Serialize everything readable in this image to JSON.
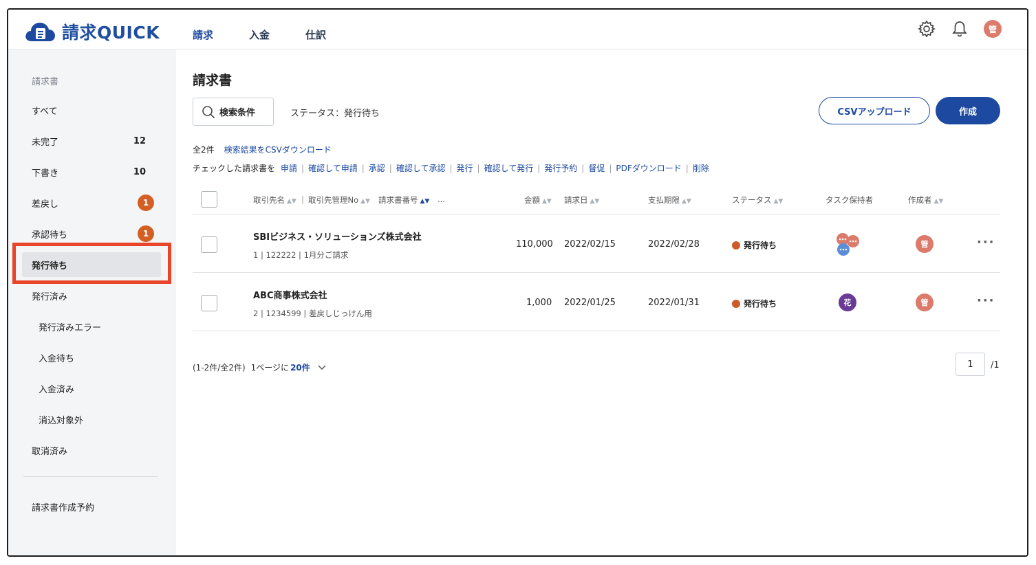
{
  "app": {
    "name": "請求QUICK",
    "brand_color": "#1d4aa0",
    "accent_color": "#d45f24"
  },
  "header": {
    "tabs": [
      {
        "label": "請求",
        "active": true
      },
      {
        "label": "入金",
        "active": false
      },
      {
        "label": "仕訳",
        "active": false
      }
    ],
    "icons": [
      "gear-icon",
      "bell-icon"
    ],
    "user_avatar": "管"
  },
  "sidebar": {
    "heading": "請求書",
    "items": [
      {
        "label": "すべて"
      },
      {
        "label": "未完了",
        "count": "12"
      },
      {
        "label": "下書き",
        "count": "10"
      },
      {
        "label": "差戻し",
        "badge": "1"
      },
      {
        "label": "承認待ち",
        "badge": "1"
      },
      {
        "label": "発行待ち",
        "selected": true
      },
      {
        "label": "発行済み"
      },
      {
        "label": "発行済みエラー"
      },
      {
        "label": "入金待ち"
      },
      {
        "label": "入金済み"
      },
      {
        "label": "消込対象外"
      },
      {
        "label": "取消済み"
      }
    ],
    "footer_item": "請求書作成予約"
  },
  "main": {
    "title": "請求書",
    "search_button": "検索条件",
    "status_filter": "ステータス：発行待ち",
    "csv_upload": "CSVアップロード",
    "create": "作成",
    "count_text": "全2件",
    "csv_download": "検索結果をCSVダウンロード",
    "bulk_prefix": "チェックした請求書を",
    "bulk_actions": [
      "申請",
      "確認して申請",
      "承認",
      "確認して承認",
      "発行",
      "確認して発行",
      "発行予約",
      "督促",
      "PDFダウンロード",
      "削除"
    ]
  },
  "table": {
    "headers": {
      "client": "取引先名",
      "sep": "|",
      "client_no": "取引先管理No",
      "invoice_no": "請求書番号",
      "more": "...",
      "amount": "金額",
      "date": "請求日",
      "due": "支払期限",
      "status": "ステータス",
      "task_owner": "タスク保持者",
      "author": "作成者"
    },
    "rows": [
      {
        "client": "SBIビジネス・ソリューションズ株式会社",
        "sub": "1 | 122222 | 1月分ご請求",
        "amount": "110,000",
        "date": "2022/02/15",
        "due": "2022/02/28",
        "status": "発行待ち",
        "author": "管"
      },
      {
        "client": "ABC商事株式会社",
        "sub": "2 | 1234599 | 差戻しじっけん用",
        "amount": "1,000",
        "date": "2022/01/25",
        "due": "2022/01/31",
        "status": "発行待ち",
        "task_owner": "花",
        "author": "管"
      }
    ]
  },
  "pagination": {
    "range": "(1-2件/全2件)",
    "per_page_prefix": "1ページに",
    "per_page": "20件",
    "current_page": "1",
    "total_pages": "/1"
  }
}
